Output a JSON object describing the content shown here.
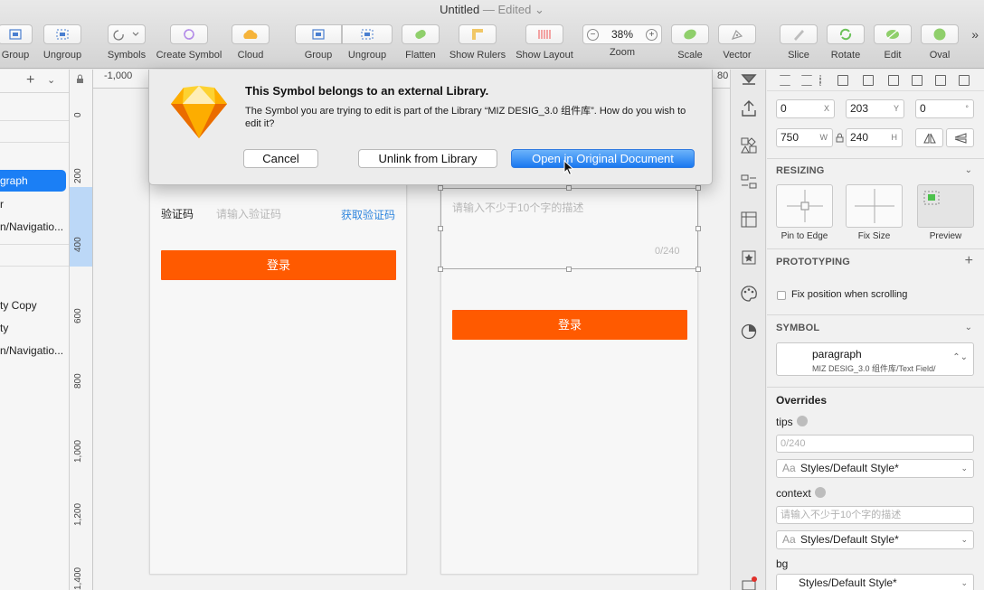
{
  "window": {
    "title": "Untitled",
    "status": "— Edited",
    "status_chevron": "⌄"
  },
  "toolbar": {
    "items": [
      {
        "label": "Group"
      },
      {
        "label": "Ungroup"
      },
      {
        "label": "Symbols"
      },
      {
        "label": "Create Symbol"
      },
      {
        "label": "Cloud"
      },
      {
        "label": "Group"
      },
      {
        "label": "Ungroup"
      },
      {
        "label": "Flatten"
      },
      {
        "label": "Show Rulers"
      },
      {
        "label": "Show Layout"
      },
      {
        "label": "Zoom"
      },
      {
        "label": "Scale"
      },
      {
        "label": "Vector"
      },
      {
        "label": "Slice"
      },
      {
        "label": "Rotate"
      },
      {
        "label": "Edit"
      },
      {
        "label": "Oval"
      }
    ],
    "zoom": {
      "value": "38%",
      "minus": "−",
      "plus": "+"
    },
    "more": "»"
  },
  "layers": {
    "add": "+",
    "collapse": "⌄",
    "items": [
      "graph",
      "r",
      "n/Navigatio...",
      "ty Copy",
      "ty",
      "n/Navigatio..."
    ]
  },
  "rulers": {
    "h_start": "-1,000",
    "h_end": "80",
    "v_ticks": [
      "0",
      "200",
      "400",
      "600",
      "800",
      "1,000",
      "1,200",
      "1,400"
    ]
  },
  "canvas": {
    "left": {
      "label": "验证码",
      "placeholder": "请输入验证码",
      "link": "获取验证码",
      "button": "登录"
    },
    "right": {
      "placeholder": "请输入不少于10个字的描述",
      "counter": "0/240",
      "button": "登录"
    }
  },
  "dialog": {
    "title": "This Symbol belongs to an external Library.",
    "message": "The Symbol you are trying to edit is part of the Library “MIZ DESIG_3.0 组件库”. How do you wish to edit it?",
    "cancel": "Cancel",
    "unlink": "Unlink from Library",
    "open": "Open in Original Document"
  },
  "inspector": {
    "x": {
      "value": "0",
      "suffix": "X"
    },
    "y": {
      "value": "203",
      "suffix": "Y"
    },
    "rotation": {
      "value": "0",
      "suffix": "°"
    },
    "w": {
      "value": "750",
      "suffix": "W"
    },
    "h": {
      "value": "240",
      "suffix": "H"
    },
    "resizing": {
      "title": "RESIZING",
      "options": [
        "Pin to Edge",
        "Fix Size",
        "Preview"
      ]
    },
    "prototyping": {
      "title": "PROTOTYPING",
      "add": "+",
      "fix_position": "Fix position when scrolling"
    },
    "symbol": {
      "title": "SYMBOL",
      "name": "paragraph",
      "path": "MIZ DESIG_3.0 组件库/Text Field/"
    },
    "overrides": {
      "title": "Overrides",
      "tips_label": "tips",
      "tips_placeholder": "0/240",
      "tips_style": "Styles/Default Style*",
      "context_label": "context",
      "context_placeholder": "请输入不少于10个字的描述",
      "context_style": "Styles/Default Style*",
      "bg_label": "bg",
      "bg_style": "Styles/Default Style*",
      "style_prefix": "Aa"
    }
  },
  "colors": {
    "accent": "#1b7ff5",
    "orange": "#ff5a00",
    "link": "#2f86de"
  }
}
